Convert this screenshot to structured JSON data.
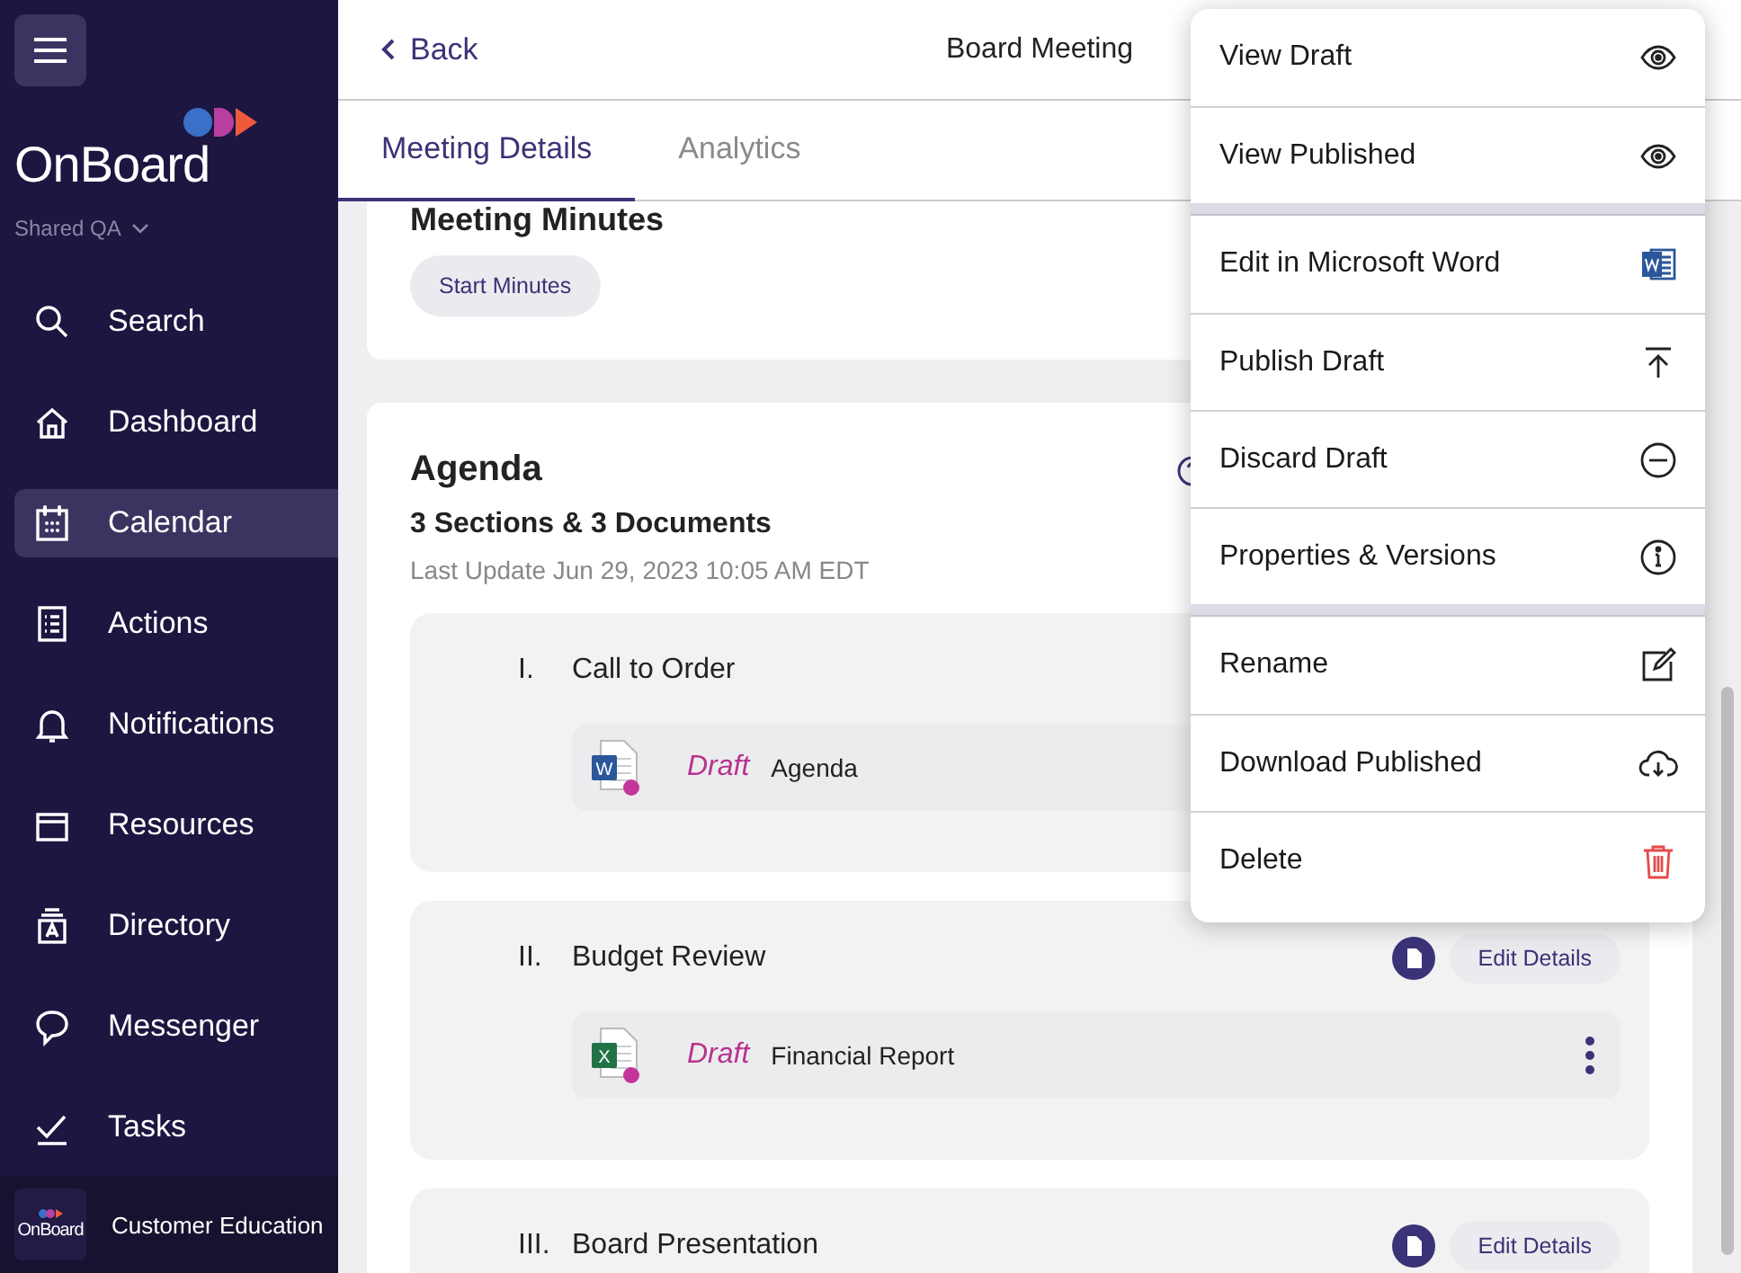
{
  "sidebar": {
    "brand": "OnBoard",
    "workspace": "Shared QA",
    "items": [
      {
        "label": "Search",
        "kind": "search",
        "selected": false
      },
      {
        "label": "Dashboard",
        "kind": "home",
        "selected": false
      },
      {
        "label": "Calendar",
        "kind": "calendar",
        "selected": true
      },
      {
        "label": "Actions",
        "kind": "list",
        "selected": false
      },
      {
        "label": "Notifications",
        "kind": "bell",
        "selected": false
      },
      {
        "label": "Resources",
        "kind": "folder",
        "selected": false
      },
      {
        "label": "Directory",
        "kind": "directory",
        "selected": false
      },
      {
        "label": "Messenger",
        "kind": "chat",
        "selected": false
      },
      {
        "label": "Tasks",
        "kind": "check",
        "selected": false
      }
    ],
    "footer": {
      "logo_text": "OnBoard",
      "org": "Customer Education"
    }
  },
  "header": {
    "back": "Back",
    "title": "Board Meeting"
  },
  "tabs": [
    {
      "label": "Meeting Details",
      "selected": true
    },
    {
      "label": "Analytics",
      "selected": false
    }
  ],
  "minutes": {
    "title": "Meeting Minutes",
    "button": "Start Minutes"
  },
  "agenda": {
    "title": "Agenda",
    "summary": "3 Sections & 3 Documents",
    "updated": "Last Update Jun 29, 2023 10:05 AM EDT",
    "sections": [
      {
        "numeral": "I.",
        "title": "Call to Order",
        "documents": [
          {
            "kind": "word",
            "letter": "W",
            "status": "Draft",
            "name": "Agenda"
          }
        ]
      },
      {
        "numeral": "II.",
        "title": "Budget Review",
        "edit": "Edit Details",
        "documents": [
          {
            "kind": "excel",
            "letter": "X",
            "status": "Draft",
            "name": "Financial Report"
          }
        ]
      },
      {
        "numeral": "III.",
        "title": "Board Presentation",
        "edit": "Edit Details"
      }
    ]
  },
  "menu": {
    "groups": [
      [
        {
          "label": "View Draft",
          "kind": "view"
        },
        {
          "label": "View Published",
          "kind": "view"
        }
      ],
      [
        {
          "label": "Edit in Microsoft Word",
          "kind": "word"
        },
        {
          "label": "Publish Draft",
          "kind": "publish"
        },
        {
          "label": "Discard Draft",
          "kind": "discard"
        },
        {
          "label": "Properties & Versions",
          "kind": "info"
        }
      ],
      [
        {
          "label": "Rename",
          "kind": "rename"
        },
        {
          "label": "Download Published",
          "kind": "download"
        },
        {
          "label": "Delete",
          "kind": "delete"
        }
      ]
    ]
  }
}
